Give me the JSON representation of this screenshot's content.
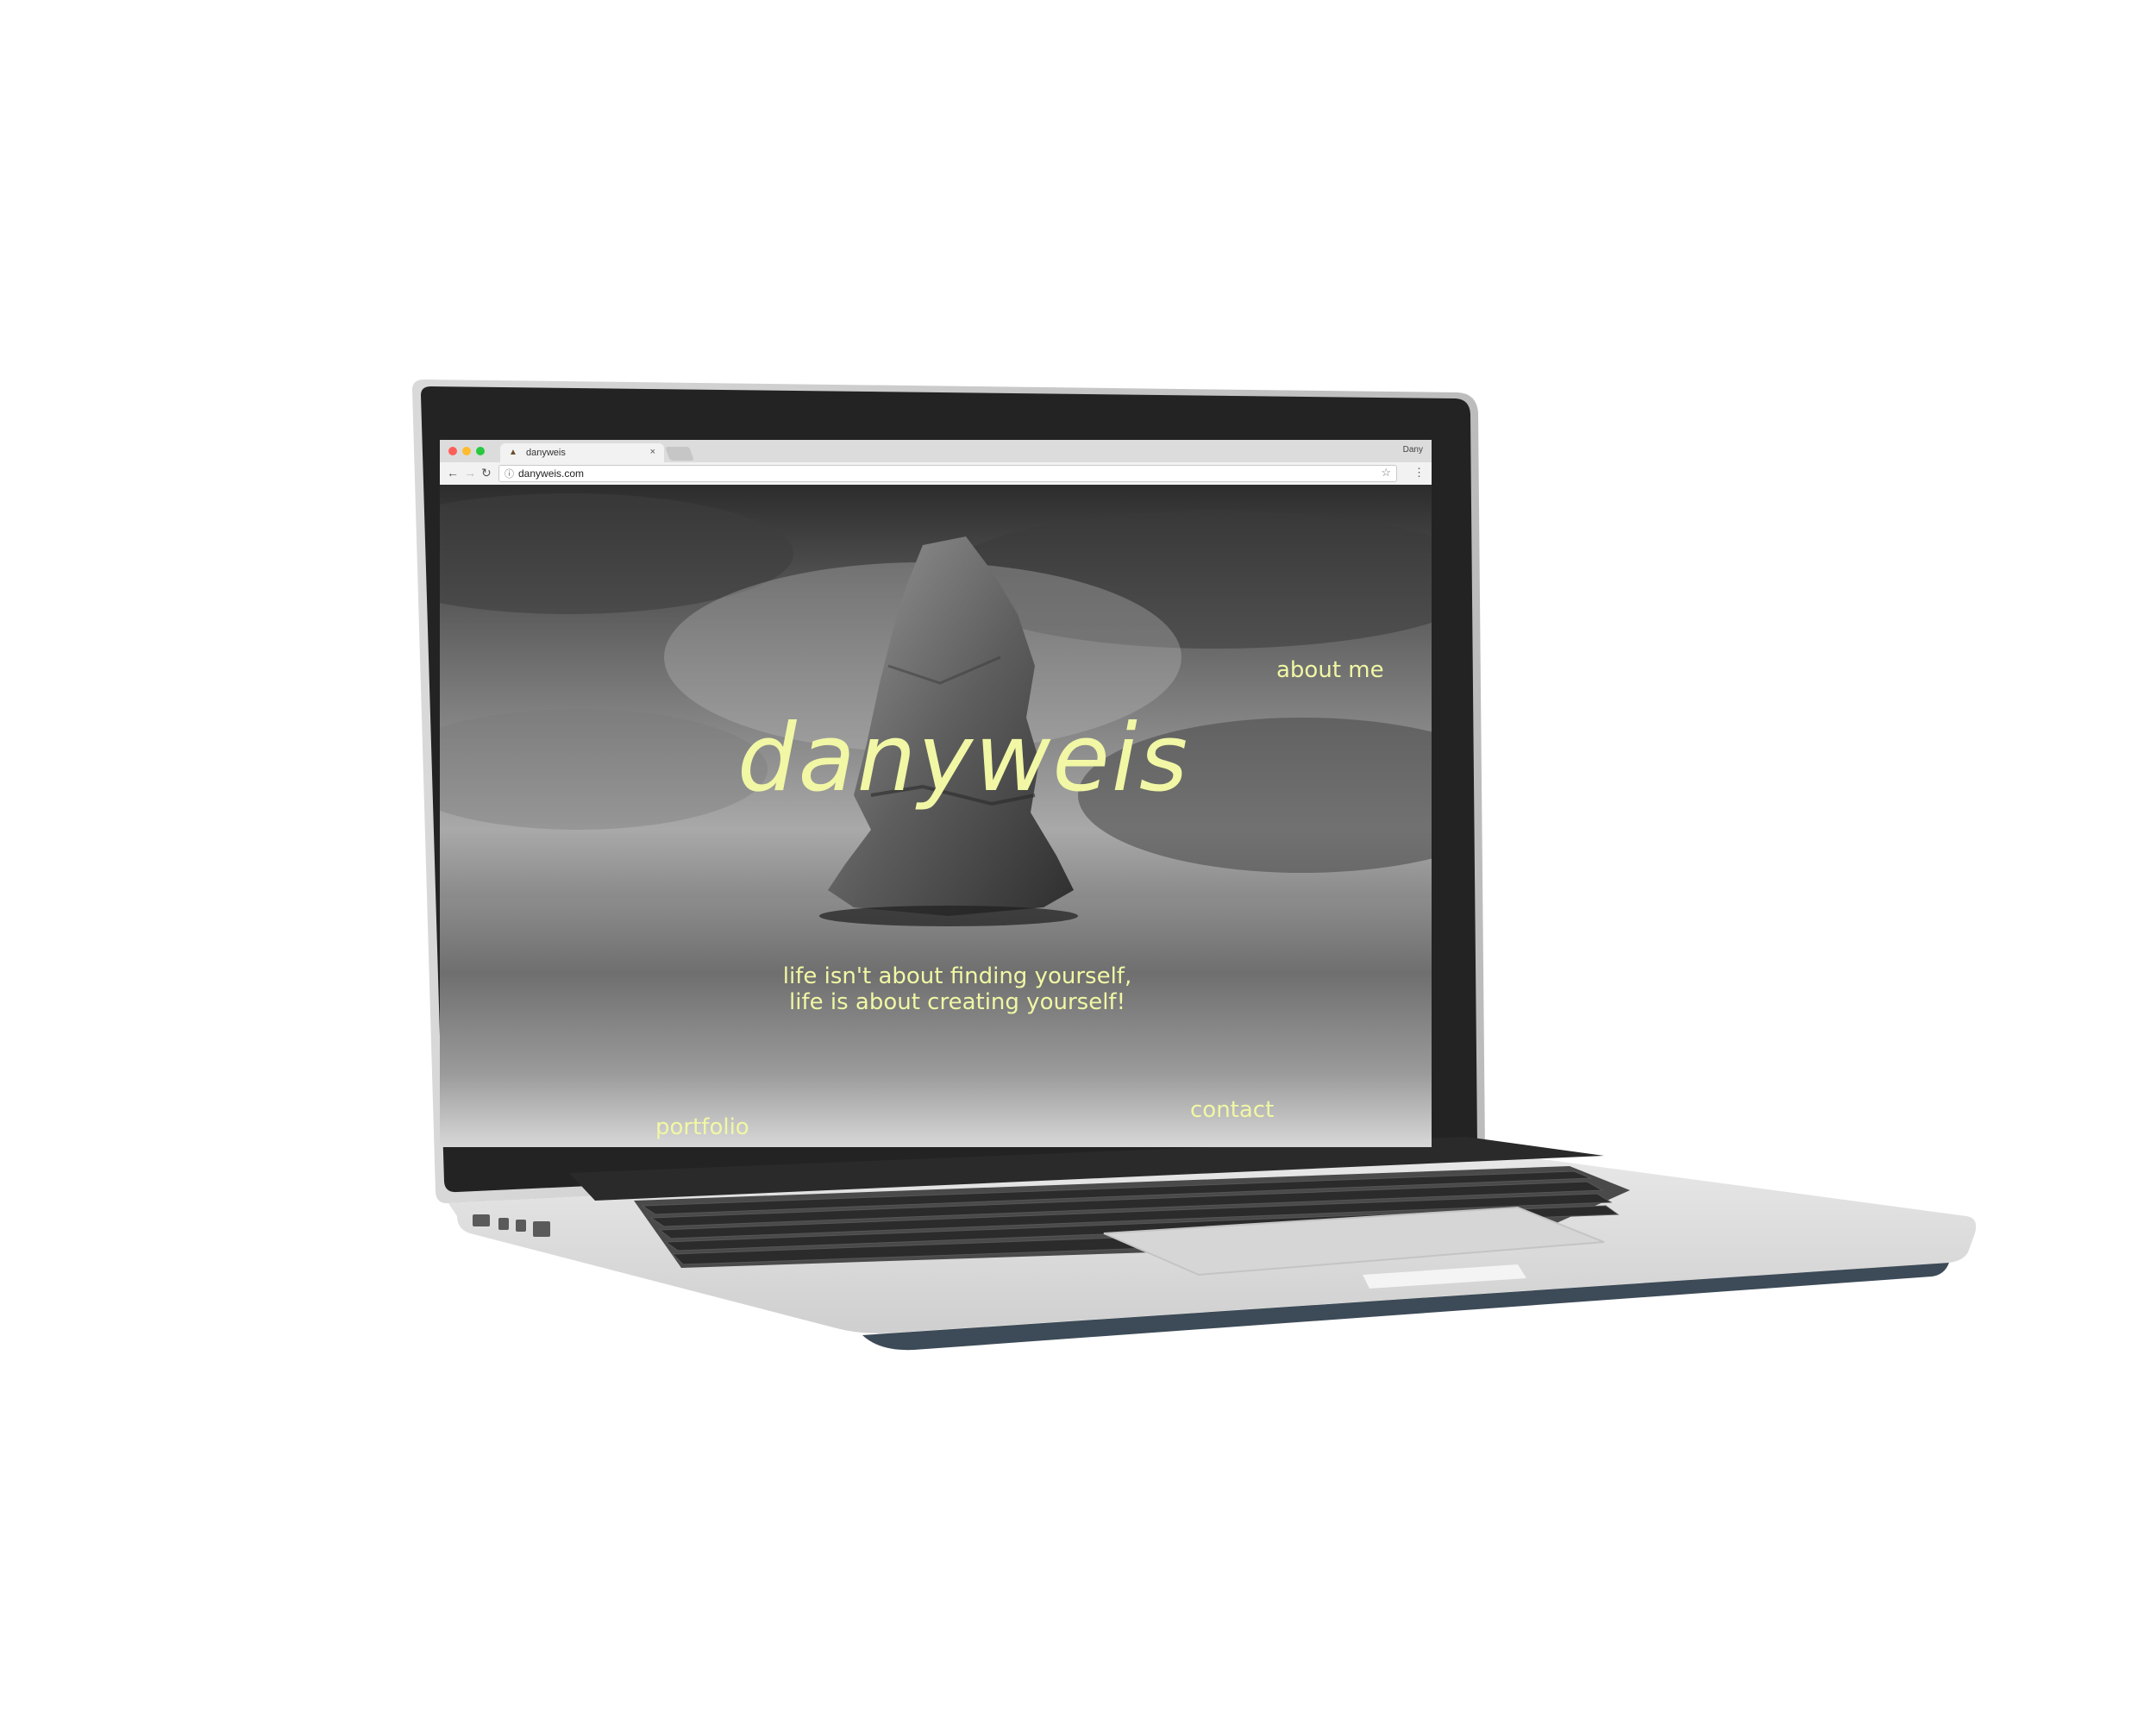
{
  "browser": {
    "tab_title": "danyweis",
    "tab_close": "×",
    "profile_name": "Dany",
    "url": "danyweis.com",
    "icons": {
      "back": "arrow-left-icon",
      "forward": "arrow-right-icon",
      "reload": "reload-icon",
      "info": "info-icon",
      "bookmark": "star-icon",
      "menu": "more-vert-icon"
    },
    "glyphs": {
      "back": "←",
      "forward": "→",
      "reload": "↻",
      "info": "ⓘ",
      "star": "☆",
      "menu": "⋮",
      "favicon": "▲"
    }
  },
  "site": {
    "brand": "danyweis",
    "tagline_line1": "life isn't about finding yourself,",
    "tagline_line2": "life is about creating yourself!",
    "nav": {
      "about": "about me",
      "contact": "contact",
      "portfolio": "portfolio"
    },
    "accent_color": "#f1f7a4"
  }
}
